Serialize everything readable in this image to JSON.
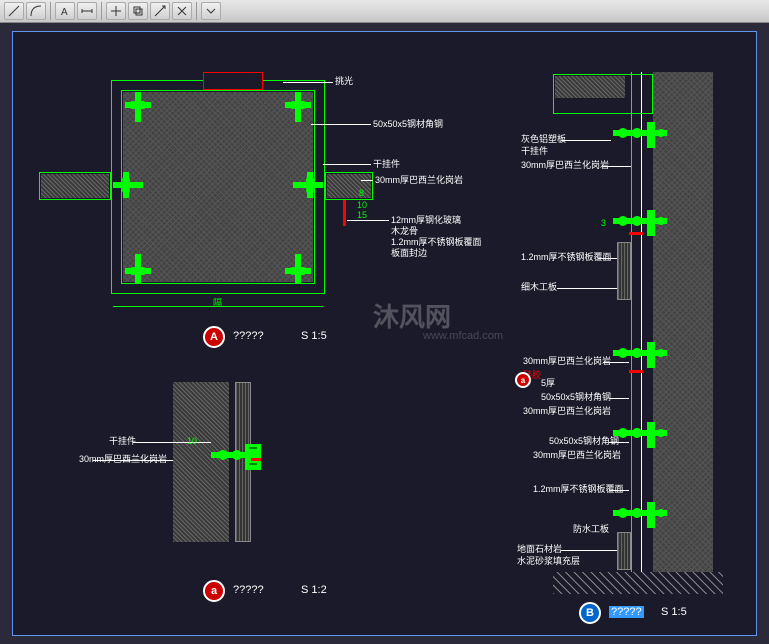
{
  "toolbar": {
    "icons": [
      "draw",
      "arc",
      "text",
      "dim",
      "move",
      "copy",
      "scale",
      "trim"
    ]
  },
  "drawings": {
    "A": {
      "bubble": "A",
      "title": "?????",
      "scale": "S 1:5"
    },
    "a": {
      "bubble": "a",
      "title": "?????",
      "scale": "S 1:2"
    },
    "B": {
      "bubble": "B",
      "title": "?????",
      "scale": "S 1:5"
    }
  },
  "labels": {
    "l1": "挑光",
    "l2": "50x50x5钢材角钢",
    "l3": "干挂件",
    "l4": "30mm厚巴西兰化岗岩",
    "l5": "12mm厚钢化玻璃",
    "l6": "木龙骨",
    "l7": "1.2mm厚不锈钢板覆面",
    "l8": "板面封边",
    "l9": "灰色铝塑板",
    "l10": "干挂件",
    "l11": "30mm厚巴西兰化岗岩",
    "l12": "1.2mm厚不锈钢板覆面",
    "l13": "细木工板",
    "l14": "30mm厚巴西兰化岗岩",
    "l15": "硅胶",
    "l16": "5厚",
    "l17": "50x50x5钢材角钢",
    "l18": "30mm厚巴西兰化岗岩",
    "l19": "50x50x5钢材角钢",
    "l20": "30mm厚巴西兰化岗岩",
    "l21": "1.2mm厚不锈钢板覆面",
    "l22": "地面石材岩",
    "l23": "水泥砂浆填充层",
    "l24": "防水工板",
    "l25": "干挂件",
    "l26": "30mm厚巴西兰化岗岩",
    "l27": "3"
  },
  "dims": {
    "d1": "8",
    "d2": "10",
    "d3": "15",
    "d4": "隔",
    "d5": "10"
  },
  "watermark": {
    "main": "沐风网",
    "sub": "www.mfcad.com"
  }
}
